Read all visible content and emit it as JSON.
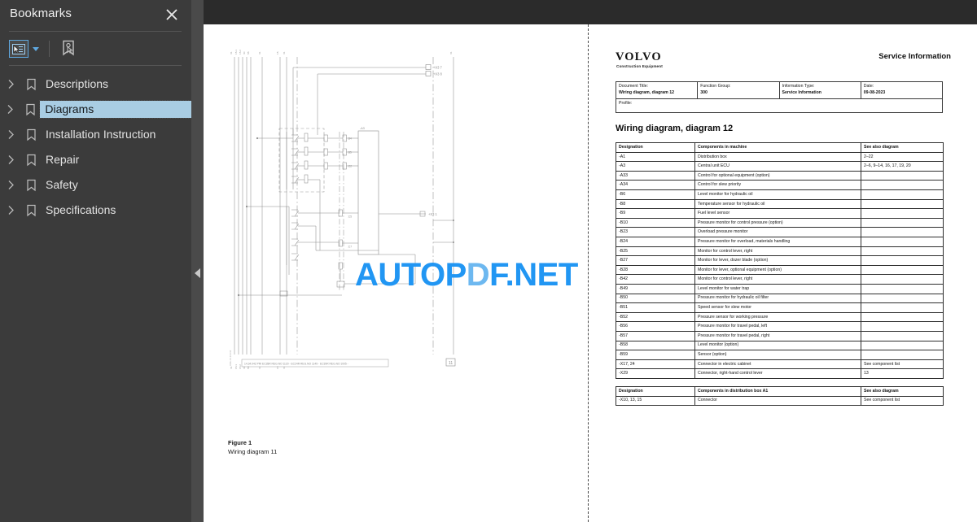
{
  "sidebar": {
    "title": "Bookmarks",
    "close_icon": "close-icon",
    "toolbar": {
      "options_icon": "bookmark-options-icon",
      "caret_icon": "chevron-down-icon",
      "new_bookmark_icon": "new-bookmark-icon"
    },
    "items": [
      {
        "label": "Descriptions",
        "expand_icon": "chevron-right-icon",
        "bookmark_icon": "bookmark-icon",
        "selected": false
      },
      {
        "label": "Diagrams",
        "expand_icon": "chevron-right-icon",
        "bookmark_icon": "bookmark-icon",
        "selected": true
      },
      {
        "label": "Installation Instruction",
        "expand_icon": "chevron-right-icon",
        "bookmark_icon": "bookmark-icon",
        "selected": false
      },
      {
        "label": "Repair",
        "expand_icon": "chevron-right-icon",
        "bookmark_icon": "bookmark-icon",
        "selected": false
      },
      {
        "label": "Safety",
        "expand_icon": "chevron-right-icon",
        "bookmark_icon": "bookmark-icon",
        "selected": false
      },
      {
        "label": "Specifications",
        "expand_icon": "chevron-right-icon",
        "bookmark_icon": "bookmark-icon",
        "selected": false
      }
    ],
    "collapse_icon": "collapse-panel-arrow-icon",
    "colors": {
      "panel_bg": "#3b3b3b",
      "selection_bg": "#a9cde3",
      "accent": "#5fa8e0"
    }
  },
  "watermark": {
    "text_part1": "AUTOP",
    "text_part2": "D",
    "text_part3": "F.NET",
    "color": "#2196f3",
    "color_soft": "#6db8f0"
  },
  "left_page": {
    "figure_number": "Figure 1",
    "figure_caption": "Wiring diagram 11",
    "diagram_name": "wiring-diagram-schematic",
    "title_block": "14.34.042 PRI    EC28R REG.NO 1120 -  EC24R REG.NO 1149 -  EC39R REG.NO 1005 -",
    "right_connector_labels": [
      "+X3 7",
      "+X3 8",
      "+X3 1"
    ],
    "corner_box": "11"
  },
  "document": {
    "brand": "VOLVO",
    "brand_sub": "Construction Equipment",
    "service_information": "Service Information",
    "meta": {
      "document_title_label": "Document Title:",
      "document_title_value": "Wiring diagram, diagram 12",
      "function_group_label": "Function Group:",
      "function_group_value": "300",
      "information_type_label": "Information Type:",
      "information_type_value": "Service Information",
      "date_label": "Date:",
      "date_value": "09-08-2023",
      "profile_label": "Profile:",
      "profile_value": ""
    },
    "title": "Wiring diagram, diagram 12",
    "table1": {
      "headers": [
        "Designation",
        "Components in machine",
        "See also diagram"
      ],
      "rows": [
        [
          "-A1",
          "Distribution box",
          "2–22"
        ],
        [
          "-A3",
          "Central unit ECU",
          "2–6, 9–14, 16, 17, 19, 20"
        ],
        [
          "-A33",
          "Control for optional equipment (option)",
          ""
        ],
        [
          "-A34",
          "Control for slew priority",
          ""
        ],
        [
          "-B6",
          "Level monitor for hydraulic oil",
          ""
        ],
        [
          "-B8",
          "Temperature sensor for hydraulic oil",
          ""
        ],
        [
          "-B9",
          "Fuel level sensor",
          ""
        ],
        [
          "-B10",
          "Pressure monitor for control pressure (option)",
          ""
        ],
        [
          "-B23",
          "Overload pressure monitor",
          ""
        ],
        [
          "-B24",
          "Pressure monitor for overload, materials handling",
          ""
        ],
        [
          "-B25",
          "Monitor for control lever, right",
          ""
        ],
        [
          "-B27",
          "Monitor for lever, dozer blade (option)",
          ""
        ],
        [
          "-B28",
          "Monitor for lever, optional equipment (option)",
          ""
        ],
        [
          "-B42",
          "Monitor for control lever, right",
          ""
        ],
        [
          "-B49",
          "Level monitor for water trap",
          ""
        ],
        [
          "-B50",
          "Pressure monitor for hydraulic oil filter",
          ""
        ],
        [
          "-B51",
          "Speed sensor for slew motor",
          ""
        ],
        [
          "-B52",
          "Pressure sensor for working pressure",
          ""
        ],
        [
          "-B56",
          "Pressure monitor for travel pedal, left",
          ""
        ],
        [
          "-B57",
          "Pressure monitor for travel pedal, right",
          ""
        ],
        [
          "-B58",
          "Level monitor (option)",
          ""
        ],
        [
          "-B59",
          "Sensor (option)",
          ""
        ],
        [
          "-X17, 24",
          "Connector in electric cabinet",
          "See component list"
        ],
        [
          "-X29",
          "Connector, right-hand control lever",
          "13"
        ]
      ]
    },
    "table2": {
      "headers": [
        "Designation",
        "Components in distribution box A1",
        "See also diagram"
      ],
      "rows": [
        [
          "-X10, 13, 15",
          "Connector",
          "See component list"
        ]
      ]
    }
  }
}
